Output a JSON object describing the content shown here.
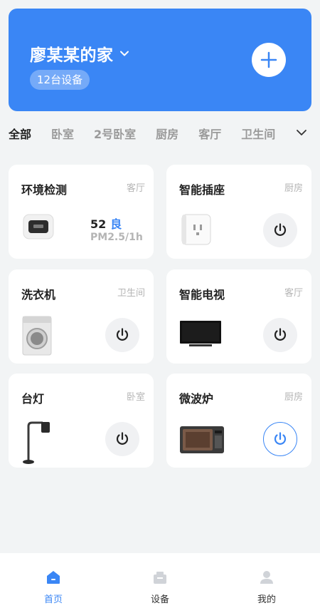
{
  "header": {
    "home_name": "廖某某的家",
    "device_count": "12台设备"
  },
  "tabs": [
    "全部",
    "卧室",
    "2号卧室",
    "厨房",
    "客厅",
    "卫生间"
  ],
  "devices": [
    {
      "name": "环境检测",
      "room": "客厅",
      "value": "52",
      "quality": "良",
      "metric": "PM2.5/1h"
    },
    {
      "name": "智能插座",
      "room": "厨房"
    },
    {
      "name": "洗衣机",
      "room": "卫生间"
    },
    {
      "name": "智能电视",
      "room": "客厅"
    },
    {
      "name": "台灯",
      "room": "卧室"
    },
    {
      "name": "微波炉",
      "room": "厨房"
    }
  ],
  "nav": [
    {
      "label": "首页"
    },
    {
      "label": "设备"
    },
    {
      "label": "我的"
    }
  ],
  "colors": {
    "accent": "#3a86f5",
    "background": "#f2f4f5",
    "muted_text": "#b5b5b5"
  }
}
